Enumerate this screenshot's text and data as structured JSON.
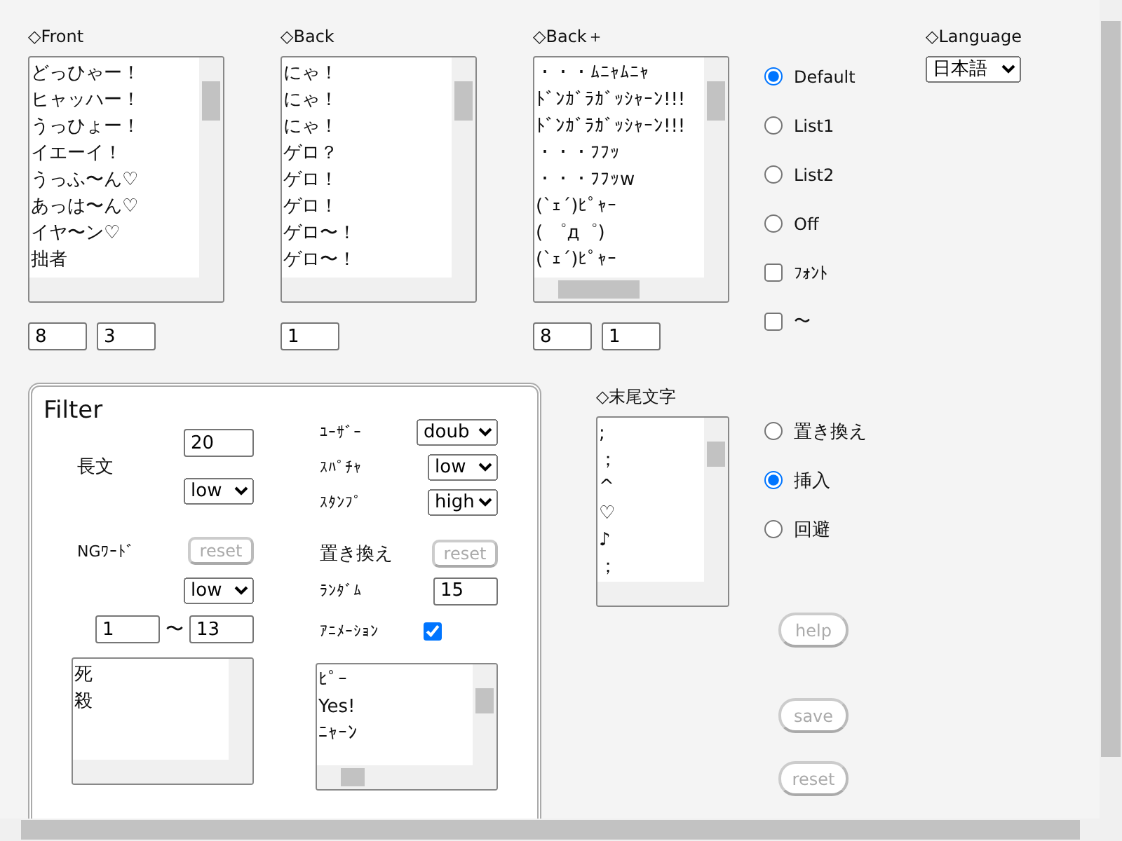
{
  "lists": [
    {
      "label": "◇Front",
      "items": [
        "どっひゃー！",
        "ヒャッハー！",
        "うっひょー！",
        "イエーイ！",
        "うっふ〜ん♡",
        "あっは〜ん♡",
        "イヤ〜ン♡",
        "拙者"
      ],
      "fields": [
        "8",
        "3"
      ]
    },
    {
      "label": "◇Back",
      "items": [
        "にゃ！",
        "にゃ！",
        "にゃ！",
        "ゲロ？",
        "ゲロ！",
        "ゲロ！",
        "ゲロ〜！",
        "ゲロ〜！"
      ],
      "fields": [
        "1"
      ]
    },
    {
      "label": "◇Back＋",
      "items": [
        "・・・ﾑﾆｬﾑﾆｬ",
        "ﾄﾞﾝｶﾞﾗｶﾞｯｼｬｰﾝ!!!",
        "ﾄﾞﾝｶﾞﾗｶﾞｯｼｬｰﾝ!!!",
        "・・・ﾌﾌｯ",
        "・・・ﾌﾌｯw",
        "(`ｪ´)ﾋﾟｬｰ",
        "( ゜д゜)",
        "(`ｪ´)ﾋﾟｬｰ"
      ],
      "fields": [
        "8",
        "1"
      ]
    }
  ],
  "mode_options": [
    {
      "kind": "radio",
      "label": "Default",
      "selected": true
    },
    {
      "kind": "radio",
      "label": "List1",
      "selected": false
    },
    {
      "kind": "radio",
      "label": "List2",
      "selected": false
    },
    {
      "kind": "radio",
      "label": "Off",
      "selected": false
    },
    {
      "kind": "checkbox",
      "label": "ﾌｫﾝﾄ",
      "checked": false
    },
    {
      "kind": "checkbox",
      "label": "〜",
      "checked": false
    }
  ],
  "language": {
    "label": "◇Language",
    "value": "日本語"
  },
  "filter": {
    "title": "Filter",
    "long_text": {
      "label": "長文",
      "value": "20",
      "level_select": "low"
    },
    "ng_word": {
      "label": "NGﾜｰﾄﾞ",
      "button": "reset",
      "button_disabled": true,
      "level_select": "low",
      "range_from": "1",
      "range_sep": "〜",
      "range_to": "13",
      "items": [
        "死",
        "殺"
      ]
    },
    "settings": [
      {
        "label": "ﾕｰｻﾞｰ",
        "value": "doub"
      },
      {
        "label": "ｽﾊﾟﾁｬ",
        "value": "low"
      },
      {
        "label": "ｽﾀﾝﾌﾟ",
        "value": "high"
      }
    ],
    "replace": {
      "label": "置き換え",
      "button": "reset",
      "button_disabled": true,
      "random_label": "ﾗﾝﾀﾞﾑ",
      "random_value": "15",
      "animation_label": "ｱﾆﾒｰｼｮﾝ",
      "animation_checked": true,
      "items": [
        "ﾋﾟｰ",
        "Yes!",
        "ﾆｬｰﾝ"
      ]
    }
  },
  "suffix": {
    "label": "◇末尾文字",
    "items": [
      ";",
      "；",
      "^",
      "♡",
      "♪",
      "；"
    ]
  },
  "suffix_options": [
    {
      "label": "置き換え",
      "selected": false
    },
    {
      "label": "挿入",
      "selected": true
    },
    {
      "label": "回避",
      "selected": false
    }
  ],
  "buttons": [
    {
      "label": "help",
      "disabled": true
    },
    {
      "label": "save",
      "disabled": true
    },
    {
      "label": "reset",
      "disabled": true
    }
  ]
}
